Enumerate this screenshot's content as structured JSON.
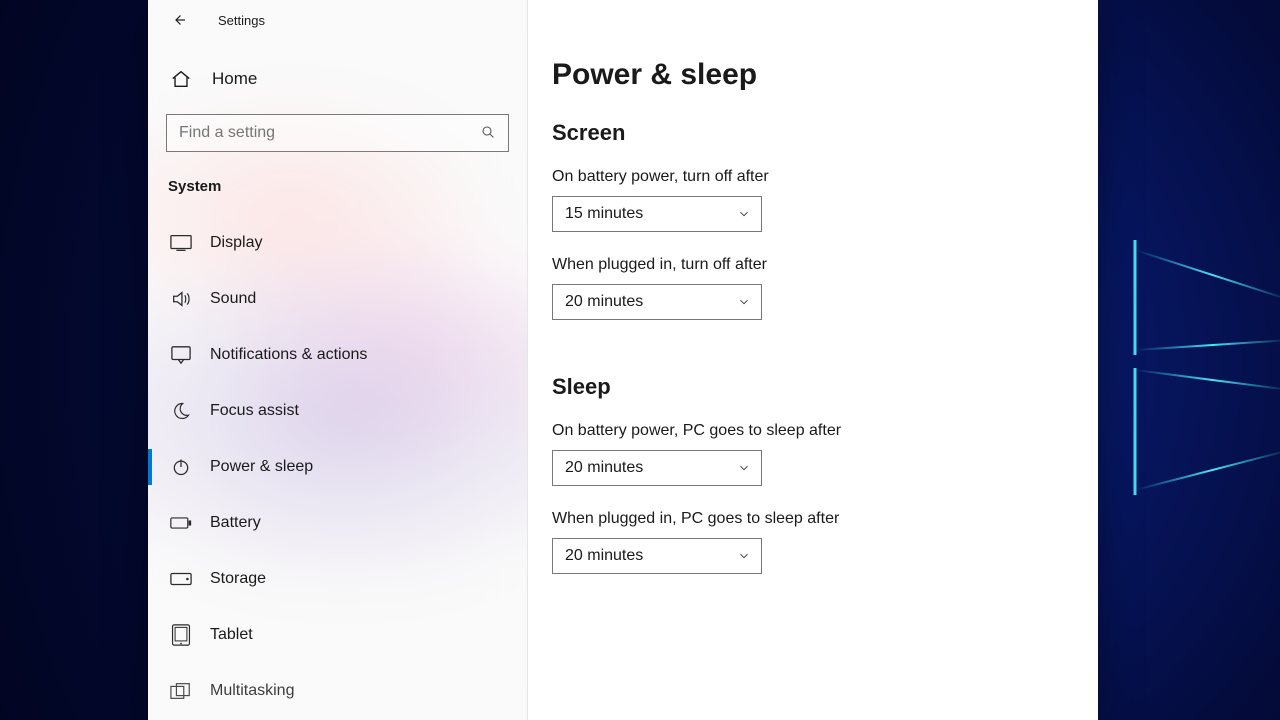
{
  "window": {
    "title": "Settings"
  },
  "sidebar": {
    "home_label": "Home",
    "search_placeholder": "Find a setting",
    "category": "System",
    "items": [
      {
        "icon": "display",
        "label": "Display",
        "active": false
      },
      {
        "icon": "sound",
        "label": "Sound",
        "active": false
      },
      {
        "icon": "notifications",
        "label": "Notifications & actions",
        "active": false
      },
      {
        "icon": "focus",
        "label": "Focus assist",
        "active": false
      },
      {
        "icon": "power",
        "label": "Power & sleep",
        "active": true
      },
      {
        "icon": "battery",
        "label": "Battery",
        "active": false
      },
      {
        "icon": "storage",
        "label": "Storage",
        "active": false
      },
      {
        "icon": "tablet",
        "label": "Tablet",
        "active": false
      },
      {
        "icon": "multitask",
        "label": "Multitasking",
        "active": false
      }
    ]
  },
  "page": {
    "title": "Power & sleep",
    "sections": {
      "screen": {
        "title": "Screen",
        "battery_label": "On battery power, turn off after",
        "battery_value": "15 minutes",
        "plugged_label": "When plugged in, turn off after",
        "plugged_value": "20 minutes"
      },
      "sleep": {
        "title": "Sleep",
        "battery_label": "On battery power, PC goes to sleep after",
        "battery_value": "20 minutes",
        "plugged_label": "When plugged in, PC goes to sleep after",
        "plugged_value": "20 minutes"
      }
    }
  }
}
